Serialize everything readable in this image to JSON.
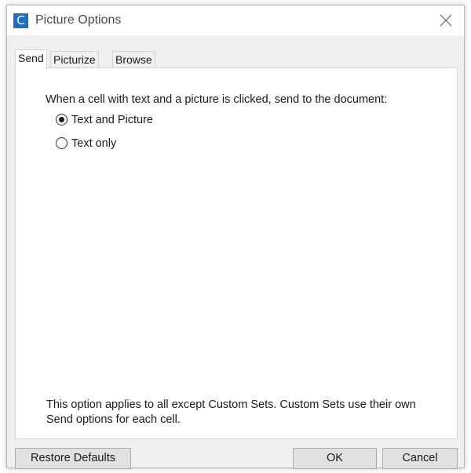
{
  "window": {
    "title": "Picture Options",
    "app_icon_letter": "C"
  },
  "tabs": [
    {
      "label": "Send",
      "active": true
    },
    {
      "label": "Picturize",
      "active": false
    },
    {
      "label": "Browse",
      "active": false
    }
  ],
  "send_panel": {
    "prompt": "When a cell with text and a picture is clicked, send to the document:",
    "options": [
      {
        "label": "Text and Picture",
        "checked": true
      },
      {
        "label": "Text only",
        "checked": false
      }
    ],
    "note": "This option applies to all except Custom Sets. Custom Sets use their own Send options for each cell."
  },
  "buttons": {
    "restore_defaults": "Restore Defaults",
    "ok": "OK",
    "cancel": "Cancel"
  },
  "colors": {
    "app_icon": "#1f6fc5",
    "dialog_background": "#f0f0f0",
    "button_face": "#e1e1e1"
  }
}
